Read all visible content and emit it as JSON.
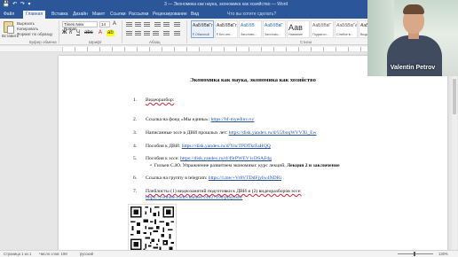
{
  "titlebar": {
    "quick_access": "💾 ↶ ↷ ▾",
    "document_title": "3 — Экономика как наука, экономика как хозяйство — Word"
  },
  "tabs": [
    {
      "label": "Файл"
    },
    {
      "label": "Главная"
    },
    {
      "label": "Вставка"
    },
    {
      "label": "Дизайн"
    },
    {
      "label": "Макет"
    },
    {
      "label": "Ссылки"
    },
    {
      "label": "Рассылки"
    },
    {
      "label": "Рецензирование"
    },
    {
      "label": "Вид"
    }
  ],
  "tell_me": "Что вы хотите сделать?",
  "ribbon": {
    "clipboard": {
      "paste": "Вставить",
      "cut": "Вырезать",
      "copy": "Копировать",
      "format_painter": "Формат по образцу",
      "group_label": "Буфер обмена"
    },
    "font": {
      "font_name": "Times New Roman",
      "font_size": "14",
      "group_label": "Шрифт"
    },
    "paragraph": {
      "group_label": "Абзац"
    },
    "styles": {
      "group_label": "Стили",
      "items": [
        {
          "sample": "АаБбВвГг",
          "name": "¶ Обычный"
        },
        {
          "sample": "АаБбВвГг",
          "name": "¶ Без инт..."
        },
        {
          "sample": "АаБбВ",
          "name": "Заголово..."
        },
        {
          "sample": "АаБбВвГ",
          "name": "Заголово..."
        },
        {
          "sample": "Аав",
          "name": "Название"
        },
        {
          "sample": "АаБбВвГ",
          "name": "Подзагол..."
        },
        {
          "sample": "АаБбВвГг",
          "name": "Слабое в..."
        },
        {
          "sample": "АаБбВвГг",
          "name": "Выделение"
        }
      ]
    }
  },
  "document": {
    "heading": "Экономика как наука, экономика как хозяйство",
    "items": [
      {
        "num": "1.",
        "text": "Видеоразбор:",
        "link": ""
      },
      {
        "num": "2.",
        "text": "Ссылка на фонд «Мы едины»: ",
        "link": "https://bf-myedinv.ru/"
      },
      {
        "num": "3.",
        "text": "Написанные эссе в ДВИ прошлых лет: ",
        "link": "https://disk.yandex.ru/d/U2boqWVVXi_Ew"
      },
      {
        "num": "4.",
        "text": "Пособия к ДВИ: ",
        "link": "https://disk.yandex.ru/d/YncTPDTkrEsHQQ"
      },
      {
        "num": "5.",
        "text": "Пособия к эссе: ",
        "link": "https://disk.yandex.ru/d/49rPWEV1cDSAFdg"
      },
      {
        "num": "6.",
        "text": "Ссылка на группу в telegram: ",
        "link": "https://t.me/+Vr8VTDdFjyIw4NDRi"
      },
      {
        "num": "7.",
        "text": "Плейлисты (1) видеозанятий подготовки к ДВИ и (2) видеоразборов эссе:",
        "link": ""
      }
    ],
    "bullet": {
      "text": "Гильеи С.Ю. Упражнение развитием экономики: курс лекций. ",
      "bold": "Лекция 2 и заключение"
    },
    "playlist_link": "https://youtube.com/channel/24027290/playlists/"
  },
  "statusbar": {
    "page": "Страница 1 из 1",
    "words": "Число слов: 198",
    "language": "русский",
    "zoom": "130%"
  },
  "webcam": {
    "name": "Valentin Petrov"
  }
}
